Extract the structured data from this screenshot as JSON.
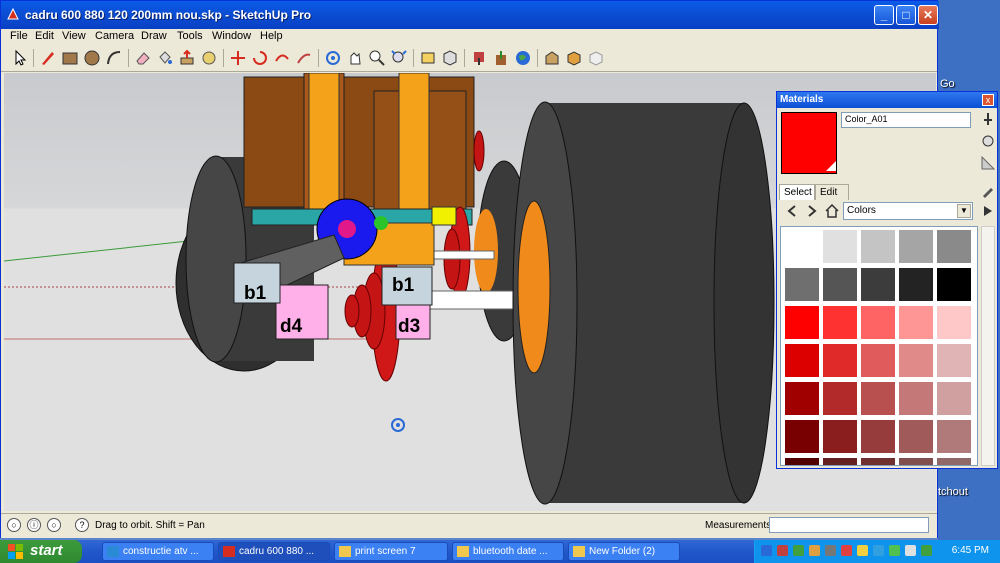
{
  "window": {
    "title": "cadru 600 880 120 200mm nou.skp - SketchUp Pro",
    "buttons": {
      "minimize": "_",
      "maximize": "□",
      "close": "✕"
    }
  },
  "menu": [
    "File",
    "Edit",
    "View",
    "Camera",
    "Draw",
    "Tools",
    "Window",
    "Help"
  ],
  "toolbar": {
    "tools": [
      "select-tool",
      "pencil-tool",
      "rectangle-tool",
      "circle-tool",
      "arc-tool",
      "eraser-tool",
      "paint-bucket-tool",
      "push-pull-tool",
      "tape-measure-tool",
      "move-tool",
      "rotate-tool",
      "offset-tool",
      "orbit-tool",
      "pan-tool",
      "zoom-tool",
      "zoom-extents-tool",
      "section-tool",
      "component-tool",
      "get-models-tool",
      "share-model-tool",
      "google-earth-tool",
      "warehouse-tool",
      "preview-tool",
      "place-model-tool"
    ]
  },
  "scene": {
    "labels": {
      "b1_left": "b1",
      "b1_right": "b1",
      "d3": "d3",
      "d4": "d4"
    }
  },
  "statusbar": {
    "message": "Drag to orbit.  Shift = Pan",
    "measurements_label": "Measurements",
    "measurements_value": ""
  },
  "materials": {
    "title": "Materials",
    "close": "x",
    "current_material": "Color_A01",
    "current_color": "#ff0000",
    "tabs": [
      "Select",
      "Edit"
    ],
    "library": "Colors",
    "swatches": [
      [
        "#ffffff",
        "#e0e0e0",
        "#c4c4c4",
        "#a5a5a5",
        "#8a8a8a"
      ],
      [
        "#6f6f6f",
        "#555555",
        "#3c3c3c",
        "#232323",
        "#000000"
      ],
      [
        "#ff0000",
        "#ff3232",
        "#ff6464",
        "#ff9696",
        "#ffc8c8"
      ],
      [
        "#dc0000",
        "#e02a2a",
        "#e05c5c",
        "#e08a8a",
        "#e0b4b4"
      ],
      [
        "#a00000",
        "#b22a2a",
        "#b85050",
        "#c47878",
        "#d0a0a0"
      ],
      [
        "#780000",
        "#8a1e1e",
        "#963c3c",
        "#a05a5a",
        "#b07a7a"
      ],
      [
        "#500000",
        "#642020",
        "#703030",
        "#805050",
        "#906868"
      ]
    ]
  },
  "desktop": {
    "labels": {
      "go": "Go",
      "sketchout": "tchout"
    }
  },
  "taskbar": {
    "start": "start",
    "tasks": [
      {
        "label": "constructie atv ...",
        "icon": "ie-icon",
        "active": false
      },
      {
        "label": "cadru 600 880 ...",
        "icon": "sketchup-icon",
        "active": true
      },
      {
        "label": "print screen 7",
        "icon": "folder-icon",
        "active": false
      },
      {
        "label": "bluetooth date ...",
        "icon": "folder-icon",
        "active": false
      },
      {
        "label": "New Folder (2)",
        "icon": "folder-icon",
        "active": false
      }
    ],
    "clock": "6:45 PM"
  }
}
